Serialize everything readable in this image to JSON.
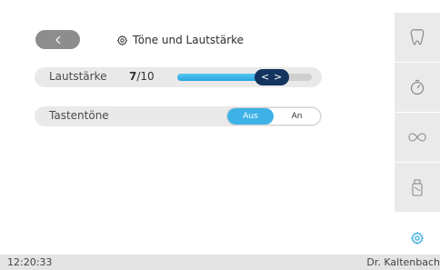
{
  "header": {
    "back_glyph": "<",
    "title": "Töne und Lautstärke",
    "title_icon": "gear-icon"
  },
  "settings": {
    "volume": {
      "label": "Lautstärke",
      "value": "7",
      "max": "/10",
      "level_fraction": 0.7,
      "prev_glyph": "<",
      "next_glyph": ">"
    },
    "key_tones": {
      "label": "Tastentöne",
      "options": [
        "Aus",
        "An"
      ],
      "selected": "Aus"
    }
  },
  "sidebar": {
    "items": [
      {
        "icon": "tooth-icon"
      },
      {
        "icon": "timer-icon"
      },
      {
        "icon": "infinity-icon"
      },
      {
        "icon": "spray-bottle-icon"
      },
      {
        "icon": "gear-icon",
        "active": true
      }
    ]
  },
  "status_bar": {
    "time": "12:20:33",
    "user": "Dr. Kaltenbach"
  },
  "colors": {
    "accent": "#3eb1e6",
    "thumb": "#15335f",
    "active_icon": "#2aa6e0"
  }
}
